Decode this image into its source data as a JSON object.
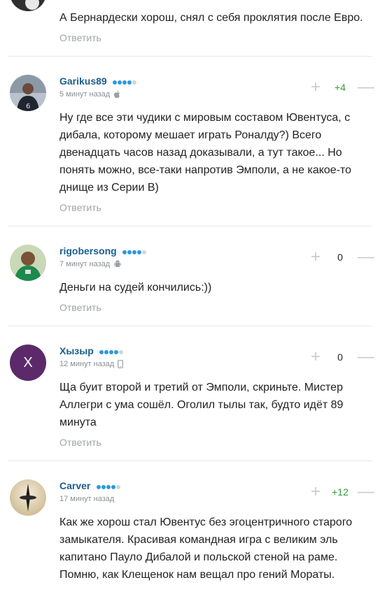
{
  "reply_label": "Ответить",
  "comments": [
    {
      "text": "А Бернардески хорош, снял с себя проклятия после Евро."
    },
    {
      "username": "Garikus89",
      "rating": 4,
      "time": "5 минут назад",
      "device": "apple-icon",
      "score": "+4",
      "text": "Ну где все эти чудики с мировым составом Ювентуса, с дибала, которому мешает играть Роналду?) Всего двенадцать часов назад доказывали, а тут такое... Но понять можно, все-таки напротив Эмполи, а не какое-то днище из Серии B)"
    },
    {
      "username": "rigobersong",
      "rating": 4,
      "time": "7 минут назад",
      "device": "android-icon",
      "score": "0",
      "text": "Деньги на судей кончились:))"
    },
    {
      "username": "Хызыр",
      "avatar_letter": "Х",
      "rating": 4,
      "time": "12 минут назад",
      "device": "phone-icon",
      "score": "0",
      "text": "Ща буит второй и третий от Эмполи, скриньте. Мистер Аллегри с ума сошёл. Оголил тылы так, будто идёт 89 минута"
    },
    {
      "username": "Carver",
      "rating": 4,
      "time": "17 минут назад",
      "score": "+12",
      "text": "Как же хорош стал Ювентус без эгоцентричного старого замыкателя. Красивая командная игра с великим эль капитано Пауло Дибалой и польской стеной на раме. Помню, как Клещенок нам вещал про гений Мораты."
    }
  ],
  "colors": {
    "username": "#1a5e8e",
    "rating_dot": "#2a9bd8",
    "positive_score": "#2e9e3a",
    "avatar_purple": "#5c2a6b"
  }
}
